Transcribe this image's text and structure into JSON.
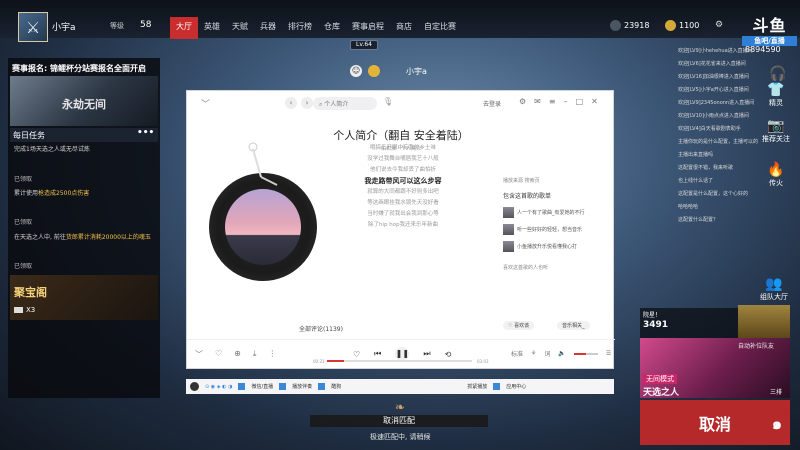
{
  "header": {
    "username": "小宇a",
    "level_label": "等级",
    "level": "58",
    "nav": [
      "大厅",
      "英雄",
      "天赋",
      "兵器",
      "排行榜",
      "仓库",
      "赛事启程",
      "商店",
      "自定比赛"
    ],
    "lv_tag": "Lv.64",
    "coins": "23918",
    "gold": "1100",
    "logo": "斗鱼",
    "logo_sub": "鱼吧/直播",
    "room_id": "8894590"
  },
  "lobby": {
    "player_name": "小宇a"
  },
  "left_panel": {
    "banner_title": "赛事报名: 锦鲤杯分站赛报名全面开启",
    "banner_text": "永劫无间",
    "tasks_title": "每日任务",
    "tasks_more": "•••",
    "tasks": [
      {
        "text": "完成1场天选之人或无尽试炼",
        "status": "已领取"
      },
      {
        "text_a": "累计使用",
        "highlight": "枪造成2500点伤害",
        "status": "已领取"
      },
      {
        "text_a": "在天选之人中, 前往",
        "highlight": "货郎累计消耗20000以上的魂玉",
        "status": "已领取"
      }
    ],
    "treasure_title": "聚宝阁",
    "treasure_count": "X3"
  },
  "player": {
    "search_placeholder": "个人简介",
    "login": "去登录",
    "song_title": "个人简介（翻自 安全着陆）",
    "artist": "佑和演 - 个人简介",
    "lyrics": [
      "哦搞乐开眼中有我的乡土味",
      "没学过我舞台嘴唇我艺十八般",
      "他们说去今我却丢了曲怕折",
      "我走路带风可以这么步容",
      "就算的大同都跟不好则多出吧",
      "等这画眼挂我水镜先天没好看",
      "当时嫌了就我出会我到那心等",
      "除了hip hop我还来乐年新曲"
    ],
    "current_lyric_index": 3,
    "comments": "全部评论(1139)",
    "rec_head": "播放来源 搜索页",
    "rec_title": "包含这首歌的歌单",
    "rec_items": [
      "人一个有了歌曲_有爱她的不行",
      "听一些好好的轻轻，想当音乐",
      "小鱼播放升乐悦看懂我心打"
    ],
    "rec_more": "喜欢这首歌的人也听",
    "like_btn": "♡ 喜欢该",
    "user_btn": "音乐相关_",
    "time_current": "00:21",
    "time_total": "03:03",
    "progress": 0.12,
    "volume": 0.5,
    "quality": "标准"
  },
  "taskbar": {
    "items": [
      "微信/直播",
      "播放伴奏",
      "酷狗",
      "抓紧播放",
      "应用中心"
    ]
  },
  "chat": [
    "欢迎[LV9]小hehehua进入直播间",
    "欢迎[LV6]花花雀来进入直播间",
    "欢迎[LV16]加油很棒进入直播间",
    "欢迎[LV5]小宇a开心进入直播间",
    "欢迎[LV9]2345ononn进入直播间",
    "欢迎[LV10]小雨点点进入直播间",
    "欢迎[LV4]白天看歌剧表助手",
    "主播你玩的是什么配置，主播可以的",
    "主播出来直播吗",
    "这配置很不错，我来听歌",
    "也上线什么话了",
    "这配置是什么配置，这个心好的",
    "哈哈哈哈",
    "这配置什么配置？"
  ],
  "right_buttons": [
    "精灵",
    "推荐关注",
    "传火",
    "组队大厅"
  ],
  "rewards": {
    "label": "院星！",
    "value": "3491"
  },
  "mode": {
    "auto": "自动补位队友",
    "tag": "无间模式",
    "name": "天选之人",
    "team": "三排"
  },
  "cancel_big": "取消",
  "match": {
    "bar": "取消匹配",
    "sub": "极速匹配中, 请稍候"
  },
  "colors": {
    "accent": "#c92d2d",
    "cancel": "#b5292a",
    "mode": "#c8286a"
  }
}
